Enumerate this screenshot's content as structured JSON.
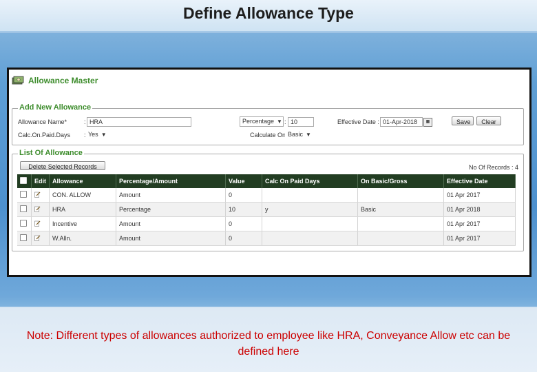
{
  "slide": {
    "title": "Define Allowance Type",
    "note": "Note: Different types of allowances authorized to employee like HRA, Conveyance Allow etc can be defined here"
  },
  "app": {
    "title": "Allowance Master",
    "logo_icon": "money-icon",
    "accent_color": "#3d8c2c",
    "header_color": "#223d22"
  },
  "add_form": {
    "legend": "Add New Allowance",
    "allowance_name_label": "Allowance Name*",
    "allowance_name_value": "HRA",
    "type_value": "Percentage",
    "value_label": ":",
    "value_value": "10",
    "effective_date_label": "Effective Date :",
    "effective_date_value": "01-Apr-2018",
    "calc_on_paid_days_label": "Calc.On.Paid.Days",
    "calc_on_paid_days_value": "Yes",
    "calculate_on_label": "Calculate On",
    "calculate_on_value": "Basic",
    "save_label": "Save",
    "clear_label": "Clear"
  },
  "list": {
    "legend": "List Of Allowance",
    "delete_label": "Delete Selected Records",
    "record_count_label": "No Of Records : 4",
    "columns": [
      "Edit",
      "Allowance",
      "Percentage/Amount",
      "Value",
      "Calc On Paid Days",
      "On Basic/Gross",
      "Effective Date"
    ],
    "rows": [
      {
        "allowance": "CON. ALLOW",
        "type": "Amount",
        "value": "0",
        "calc": "",
        "basis": "",
        "date": "01 Apr 2017"
      },
      {
        "allowance": "HRA",
        "type": "Percentage",
        "value": "10",
        "calc": "y",
        "basis": "Basic",
        "date": "01 Apr 2018"
      },
      {
        "allowance": "Incentive",
        "type": "Amount",
        "value": "0",
        "calc": "",
        "basis": "",
        "date": "01 Apr 2017"
      },
      {
        "allowance": "W.Alln.",
        "type": "Amount",
        "value": "0",
        "calc": "",
        "basis": "",
        "date": "01 Apr 2017"
      }
    ]
  }
}
